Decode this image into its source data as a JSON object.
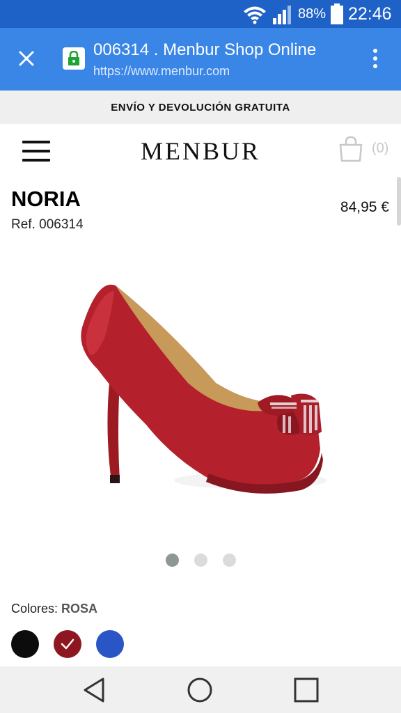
{
  "status_bar": {
    "battery_percent": "88%",
    "time": "22:46"
  },
  "browser": {
    "page_title": "006314 . Menbur Shop Online",
    "url": "https://www.menbur.com",
    "icons": [
      "close-icon",
      "lock-icon",
      "overflow-menu-icon"
    ]
  },
  "promo_banner": {
    "text": "ENVÍO Y DEVOLUCIÓN GRATUITA"
  },
  "site_header": {
    "logo": "MENBUR",
    "cart_count": "(0)",
    "icons": [
      "hamburger-menu-icon",
      "shopping-bag-icon"
    ]
  },
  "product": {
    "name": "NORIA",
    "reference": "Ref. 006314",
    "price": "84,95 €",
    "image": "red-satin-peep-toe-pump-with-rhinestone-bow",
    "carousel": {
      "total": 3,
      "active": 1
    },
    "colors_label": "Colores:",
    "selected_color": "ROSA",
    "swatches": [
      {
        "name": "black",
        "color": "#0c0c0c",
        "selected": false
      },
      {
        "name": "red",
        "color": "#8e1620",
        "selected": true
      },
      {
        "name": "blue",
        "color": "#2a55c6",
        "selected": false
      }
    ]
  },
  "colors": {
    "status_bar": "#1f62c7",
    "tab_bar": "#3a86e6",
    "banner_bg": "#efefef"
  },
  "nav_bar": {
    "icons": [
      "back-icon",
      "home-icon",
      "recents-icon"
    ]
  }
}
